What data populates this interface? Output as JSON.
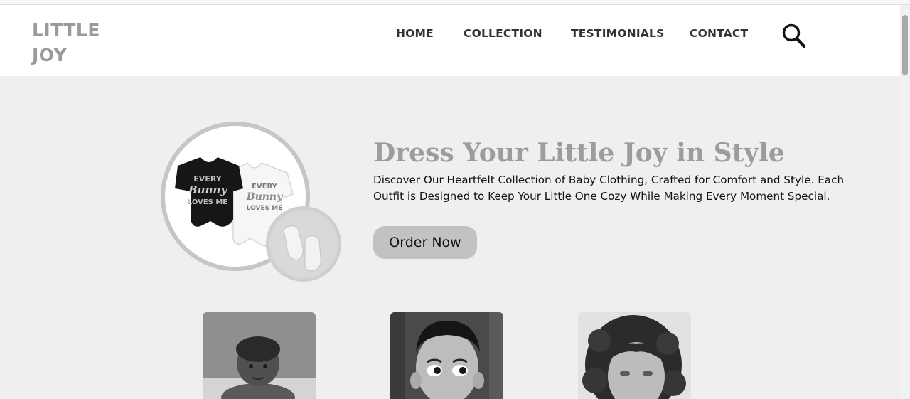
{
  "header": {
    "logo_line1": "LITTLE",
    "logo_line2": "JOY",
    "nav": [
      {
        "label": "HOME"
      },
      {
        "label": "COLLECTION"
      },
      {
        "label": "TESTIMONIALS"
      },
      {
        "label": "CONTACT"
      }
    ],
    "search_icon": "search-icon"
  },
  "hero": {
    "title": "Dress Your Little Joy in Style",
    "description": "Discover Our Heartfelt Collection of Baby Clothing, Crafted for Comfort and Style. Each Outfit is Designed to Keep Your Little One Cozy While Making Every Moment Special.",
    "button_label": "Order Now",
    "onesie_print_line1": "EVERY",
    "onesie_print_line2": "Bunny",
    "onesie_print_line3": "LOVES ME"
  },
  "products": [
    {
      "name": "baby-photo"
    },
    {
      "name": "boy-photo"
    },
    {
      "name": "girl-photo"
    }
  ],
  "colors": {
    "page_background": "#efefef",
    "header_background": "#ffffff",
    "logo": "#9a9a9a",
    "title": "#9c9c9c",
    "button": "#c2c2c2",
    "text": "#111111"
  }
}
